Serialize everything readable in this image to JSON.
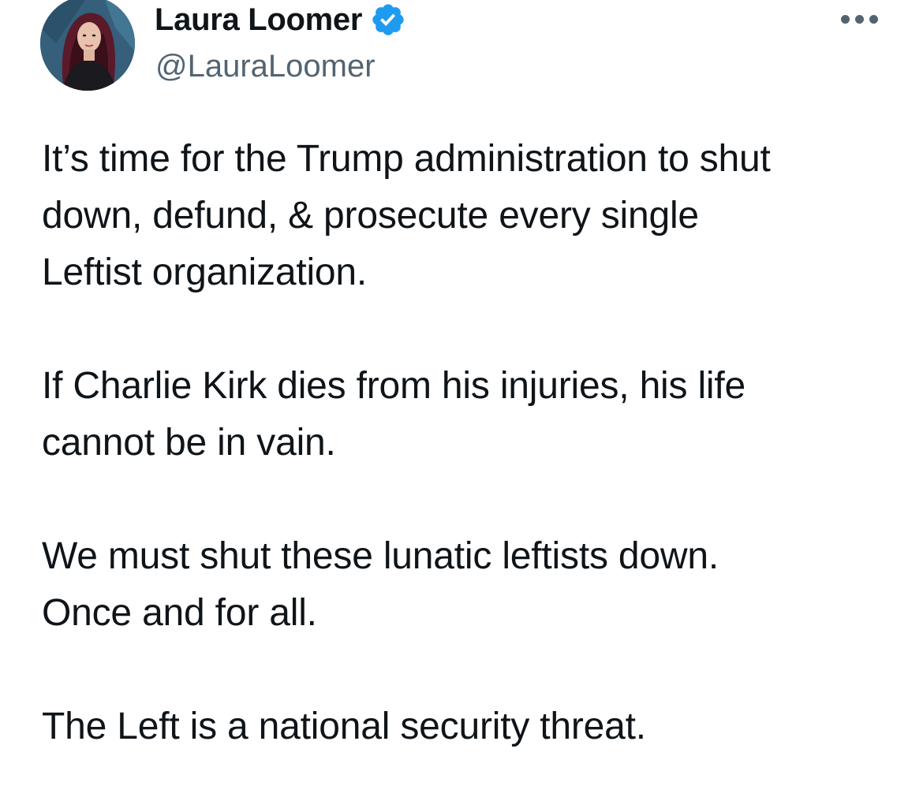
{
  "author": {
    "display_name": "Laura Loomer",
    "handle": "@LauraLoomer",
    "verified": true,
    "avatar_icon": "profile-photo",
    "verified_icon": "verified-badge-icon"
  },
  "more_icon": "more-options-icon",
  "colors": {
    "text": "#0f1419",
    "secondary": "#536471",
    "verified_blue": "#1d9bf0",
    "background": "#ffffff"
  },
  "tweet": {
    "paragraphs": [
      {
        "lines": [
          "It’s time for the Trump administration to shut",
          "down, defund, & prosecute every single",
          "Leftist organization."
        ]
      },
      {
        "lines": [
          "If Charlie Kirk dies from his injuries, his life",
          "cannot be in vain."
        ]
      },
      {
        "lines": [
          "We must shut these lunatic leftists down.",
          "Once and for all."
        ]
      },
      {
        "lines": [
          "The Left is a national security threat."
        ]
      }
    ]
  }
}
